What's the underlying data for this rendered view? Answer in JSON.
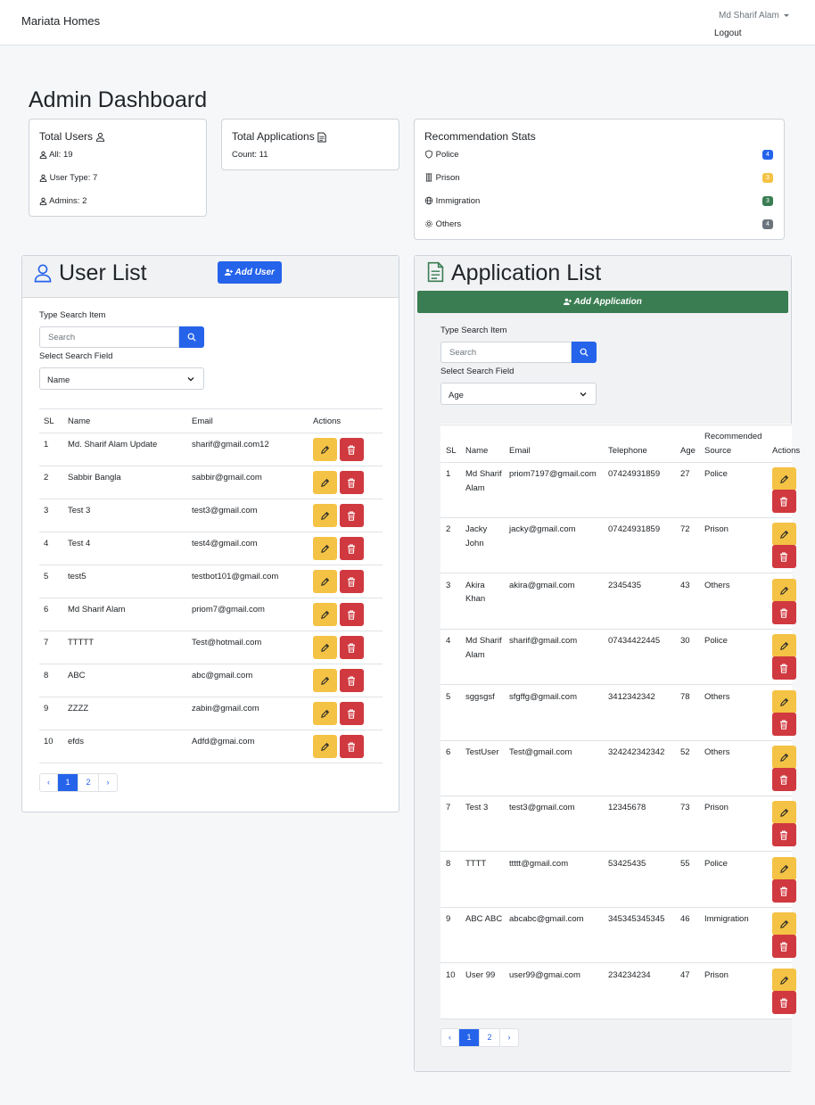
{
  "navbar": {
    "brand": "Mariata Homes",
    "user_name": "Md Sharif Alam",
    "logout": "Logout"
  },
  "page_title": "Admin Dashboard",
  "stats": {
    "users": {
      "title": "Total Users",
      "all": "All: 19",
      "user_type": "User Type: 7",
      "admins": "Admins: 2"
    },
    "applications": {
      "title": "Total Applications",
      "count": "Count: 11"
    },
    "recommendations": {
      "title": "Recommendation Stats",
      "items": [
        {
          "label": "Police",
          "count": "4",
          "color": "#2563eb",
          "icon": "shield-icon"
        },
        {
          "label": "Prison",
          "count": "3",
          "color": "#f4c244",
          "icon": "prison-icon"
        },
        {
          "label": "Immigration",
          "count": "3",
          "color": "#3a7d52",
          "icon": "globe-icon"
        },
        {
          "label": "Others",
          "count": "4",
          "color": "#6c757d",
          "icon": "gear-icon"
        }
      ]
    }
  },
  "user_list": {
    "title": "User List",
    "add_button": "Add User",
    "search_label": "Type Search Item",
    "search_placeholder": "Search",
    "field_label": "Select Search Field",
    "field_value": "Name",
    "columns": [
      "SL",
      "Name",
      "Email",
      "Actions"
    ],
    "rows": [
      {
        "sl": "1",
        "name": "Md. Sharif Alam Update",
        "email": "sharif@gmail.com12"
      },
      {
        "sl": "2",
        "name": "Sabbir Bangla",
        "email": "sabbir@gmail.com"
      },
      {
        "sl": "3",
        "name": "Test 3",
        "email": "test3@gmail.com"
      },
      {
        "sl": "4",
        "name": "Test 4",
        "email": "test4@gmail.com"
      },
      {
        "sl": "5",
        "name": "test5",
        "email": "testbot101@gmail.com"
      },
      {
        "sl": "6",
        "name": "Md Sharif Alam",
        "email": "priom7@gmail.com"
      },
      {
        "sl": "7",
        "name": "TTTTT",
        "email": "Test@hotmail.com"
      },
      {
        "sl": "8",
        "name": "ABC",
        "email": "abc@gmail.com"
      },
      {
        "sl": "9",
        "name": "ZZZZ",
        "email": "zabin@gmail.com"
      },
      {
        "sl": "10",
        "name": "efds",
        "email": "Adfd@gmai.com"
      }
    ],
    "pagination": {
      "prev": "‹",
      "pages": [
        "1",
        "2"
      ],
      "next": "›",
      "current": "1"
    }
  },
  "application_list": {
    "title": "Application List",
    "add_button": "Add Application",
    "search_label": "Type Search Item",
    "search_placeholder": "Search",
    "field_label": "Select Search Field",
    "field_value": "Age",
    "columns": [
      "SL",
      "Name",
      "Email",
      "Telephone",
      "Age",
      "Recommended Source",
      "Actions"
    ],
    "rows": [
      {
        "sl": "1",
        "name": "Md Sharif Alam",
        "email": "priom7197@gmail.com",
        "telephone": "07424931859",
        "age": "27",
        "source": "Police"
      },
      {
        "sl": "2",
        "name": "Jacky John",
        "email": "jacky@gmail.com",
        "telephone": "07424931859",
        "age": "72",
        "source": "Prison"
      },
      {
        "sl": "3",
        "name": "Akira Khan",
        "email": "akira@gmail.com",
        "telephone": "2345435",
        "age": "43",
        "source": "Others"
      },
      {
        "sl": "4",
        "name": "Md Sharif Alam",
        "email": "sharif@gmail.com",
        "telephone": "07434422445",
        "age": "30",
        "source": "Police"
      },
      {
        "sl": "5",
        "name": "sggsgsf",
        "email": "sfgffg@gmail.com",
        "telephone": "3412342342",
        "age": "78",
        "source": "Others"
      },
      {
        "sl": "6",
        "name": "TestUser",
        "email": "Test@gmail.com",
        "telephone": "324242342342",
        "age": "52",
        "source": "Others"
      },
      {
        "sl": "7",
        "name": "Test 3",
        "email": "test3@gmail.com",
        "telephone": "12345678",
        "age": "73",
        "source": "Prison"
      },
      {
        "sl": "8",
        "name": "TTTT",
        "email": "ttttt@gmail.com",
        "telephone": "53425435",
        "age": "55",
        "source": "Police"
      },
      {
        "sl": "9",
        "name": "ABC ABC",
        "email": "abcabc@gmail.com",
        "telephone": "345345345345",
        "age": "46",
        "source": "Immigration"
      },
      {
        "sl": "10",
        "name": "User 99",
        "email": "user99@gmai.com",
        "telephone": "234234234",
        "age": "47",
        "source": "Prison"
      }
    ],
    "pagination": {
      "prev": "‹",
      "pages": [
        "1",
        "2"
      ],
      "next": "›",
      "current": "1"
    }
  }
}
